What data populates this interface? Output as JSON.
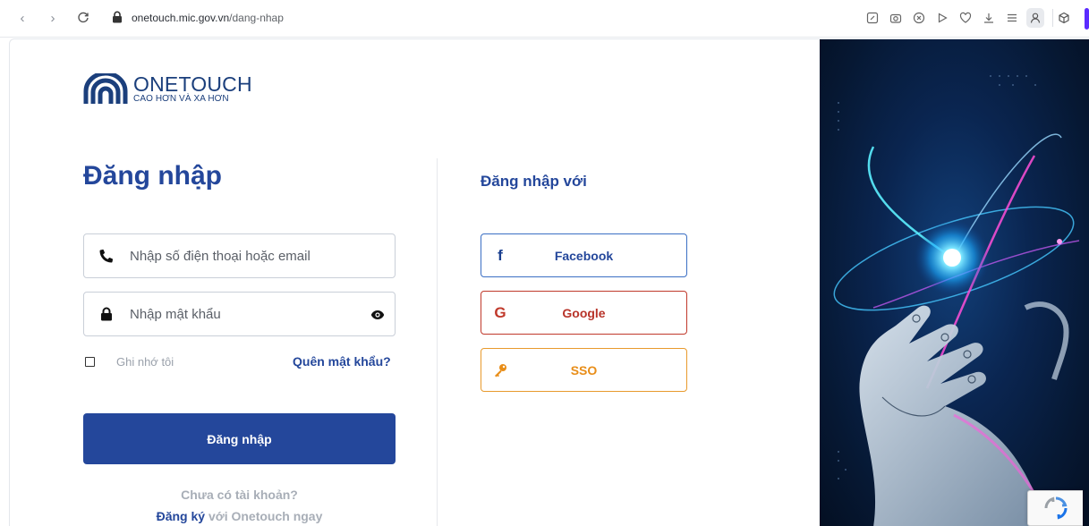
{
  "browser": {
    "url_host": "onetouch.mic.gov.vn",
    "url_path": "/dang-nhap"
  },
  "brand": {
    "title": "ONETOUCH",
    "subtitle": "CAO HƠN VÀ XA HƠN"
  },
  "login": {
    "heading": "Đăng nhập",
    "phone_placeholder": "Nhập số điện thoại hoặc email",
    "password_placeholder": "Nhập mật khẩu",
    "remember_label": "Ghi nhớ tôi",
    "forgot_label": "Quên mật khẩu?",
    "submit_label": "Đăng nhập",
    "no_account": "Chưa có tài khoản?",
    "register_link": "Đăng ký",
    "register_suffix": " với Onetouch ngay"
  },
  "social": {
    "heading": "Đăng nhập với",
    "facebook_label": "Facebook",
    "google_label": "Google",
    "sso_label": "SSO"
  },
  "colors": {
    "primary": "#24479b",
    "google": "#c0392b",
    "sso": "#e88d18"
  }
}
